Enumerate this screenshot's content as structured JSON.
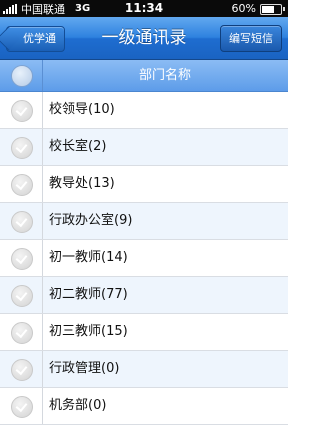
{
  "status_bar": {
    "carrier": "中国联通",
    "network": "3G",
    "time": "11:34",
    "battery": "60%"
  },
  "nav": {
    "back_label": "优学通",
    "title": "一级通讯录",
    "right_button": "编写短信"
  },
  "header": {
    "column_title": "部门名称"
  },
  "list": {
    "items": [
      {
        "label": "校领导(10)"
      },
      {
        "label": "校长室(2)"
      },
      {
        "label": "教导处(13)"
      },
      {
        "label": "行政办公室(9)"
      },
      {
        "label": "初一教师(14)"
      },
      {
        "label": "初二教师(77)"
      },
      {
        "label": "初三教师(15)"
      },
      {
        "label": "行政管理(0)"
      },
      {
        "label": "机务部(0)"
      }
    ]
  }
}
